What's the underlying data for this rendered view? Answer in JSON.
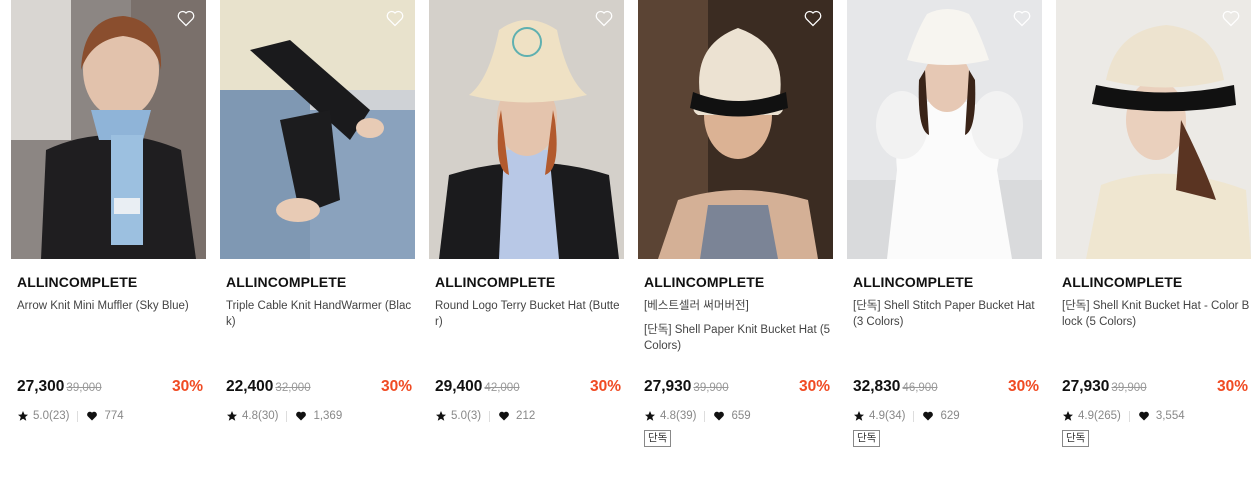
{
  "products": [
    {
      "brand": "ALLINCOMPLETE",
      "tags": "",
      "name": "Arrow Knit Mini Muffler (Sky Blue)",
      "price": "27,300",
      "original_price": "39,000",
      "discount": "30%",
      "rating": "5.0(23)",
      "likes": "774",
      "badge": ""
    },
    {
      "brand": "ALLINCOMPLETE",
      "tags": "",
      "name": "Triple Cable Knit HandWarmer (Black)",
      "price": "22,400",
      "original_price": "32,000",
      "discount": "30%",
      "rating": "4.8(30)",
      "likes": "1,369",
      "badge": ""
    },
    {
      "brand": "ALLINCOMPLETE",
      "tags": "",
      "name": "Round Logo Terry Bucket Hat (Butter)",
      "price": "29,400",
      "original_price": "42,000",
      "discount": "30%",
      "rating": "5.0(3)",
      "likes": "212",
      "badge": ""
    },
    {
      "brand": "ALLINCOMPLETE",
      "tags": "[베스트셀러 써머버전]",
      "name": "[단독] Shell Paper Knit Bucket Hat (5 Colors)",
      "price": "27,930",
      "original_price": "39,900",
      "discount": "30%",
      "rating": "4.8(39)",
      "likes": "659",
      "badge": "단독"
    },
    {
      "brand": "ALLINCOMPLETE",
      "tags": "",
      "name": "[단독] Shell Stitch Paper Bucket Hat (3 Colors)",
      "price": "32,830",
      "original_price": "46,900",
      "discount": "30%",
      "rating": "4.9(34)",
      "likes": "629",
      "badge": "단독"
    },
    {
      "brand": "ALLINCOMPLETE",
      "tags": "",
      "name": "[단독] Shell Knit Bucket Hat - Color Block (5 Colors)",
      "price": "27,930",
      "original_price": "39,900",
      "discount": "30%",
      "rating": "4.9(265)",
      "likes": "3,554",
      "badge": "단독"
    }
  ],
  "colors": {
    "discount": "#f04b23",
    "text": "#111111",
    "muted": "#888888"
  },
  "icons": {
    "wishlist": "heart-outline-icon",
    "rating": "star-icon",
    "likes": "heart-filled-icon"
  }
}
